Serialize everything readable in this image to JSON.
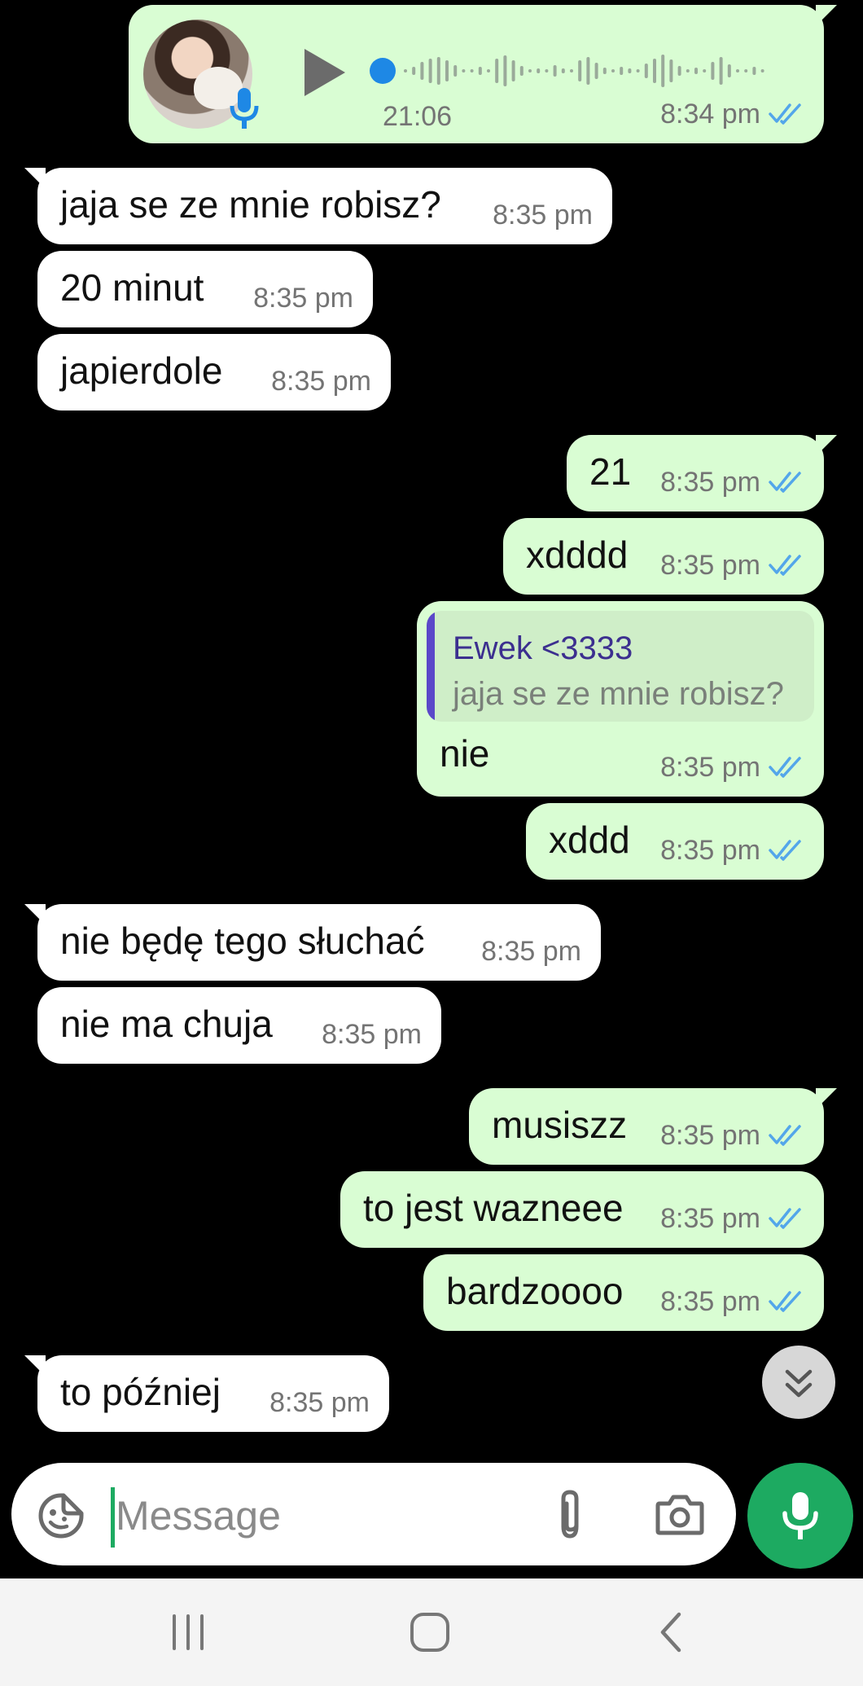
{
  "voice_message": {
    "duration": "21:06",
    "time": "8:34 pm"
  },
  "messages": [
    {
      "side": "in",
      "text": "jaja se ze mnie robisz?",
      "time": "8:35 pm"
    },
    {
      "side": "in",
      "text": "20 minut",
      "time": "8:35 pm"
    },
    {
      "side": "in",
      "text": "japierdole",
      "time": "8:35 pm"
    },
    {
      "side": "out",
      "text": "21",
      "time": "8:35 pm"
    },
    {
      "side": "out",
      "text": "xdddd",
      "time": "8:35 pm"
    },
    {
      "side": "out",
      "text": "nie",
      "time": "8:35 pm",
      "reply_to": {
        "name": "Ewek <3333",
        "text": "jaja se ze mnie robisz?"
      }
    },
    {
      "side": "out",
      "text": "xddd",
      "time": "8:35 pm"
    },
    {
      "side": "in",
      "text": "nie będę tego słuchać",
      "time": "8:35 pm"
    },
    {
      "side": "in",
      "text": "nie ma chuja",
      "time": "8:35 pm"
    },
    {
      "side": "out",
      "text": "musiszz",
      "time": "8:35 pm"
    },
    {
      "side": "out",
      "text": "to jest wazneee",
      "time": "8:35 pm"
    },
    {
      "side": "out",
      "text": "bardzoooo",
      "time": "8:35 pm"
    },
    {
      "side": "in",
      "text": "to później",
      "time": "8:35 pm"
    }
  ],
  "composer": {
    "placeholder": "Message"
  },
  "icons": {
    "emoji": "sticker-icon",
    "attach": "paperclip-icon",
    "camera": "camera-icon",
    "mic": "microphone-icon",
    "scroll": "double-chevron-down-icon",
    "read_receipt": "double-check-icon"
  },
  "colors": {
    "outgoing_bubble": "#d9fdd3",
    "incoming_bubble": "#ffffff",
    "accent": "#1daa61",
    "read_tick": "#53a6ea"
  }
}
